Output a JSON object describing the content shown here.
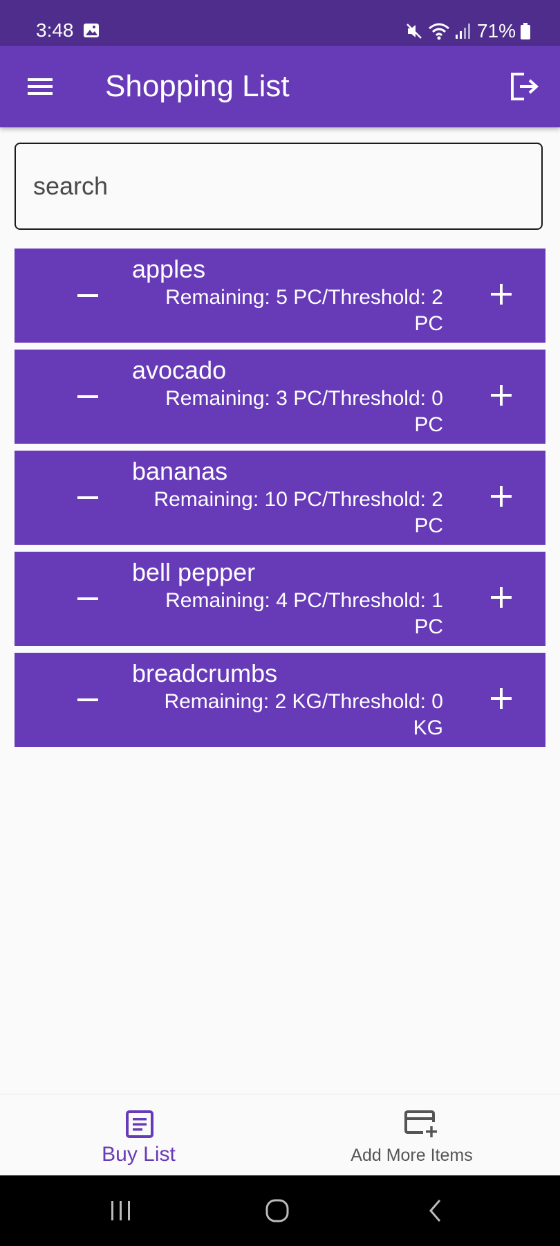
{
  "status_bar": {
    "time": "3:48",
    "battery": "71%",
    "icons": [
      "gallery-icon",
      "mute-icon",
      "wifi-icon",
      "signal-icon",
      "battery-icon"
    ]
  },
  "app_bar": {
    "title": "Shopping List",
    "icons": [
      "menu-icon",
      "logout-icon"
    ]
  },
  "search": {
    "placeholder": "search",
    "value": ""
  },
  "items": [
    {
      "name": "apples",
      "info": "Remaining: 5 PC/Threshold: 2 PC"
    },
    {
      "name": "avocado",
      "info": "Remaining: 3 PC/Threshold: 0 PC"
    },
    {
      "name": "bananas",
      "info": "Remaining: 10 PC/Threshold: 2 PC"
    },
    {
      "name": "bell pepper",
      "info": "Remaining: 4 PC/Threshold: 1 PC"
    },
    {
      "name": "breadcrumbs",
      "info": "Remaining: 2 KG/Threshold: 0 KG"
    }
  ],
  "bottom_nav": {
    "buy_list_label": "Buy List",
    "add_more_label": "Add More Items",
    "active": "Buy List"
  },
  "colors": {
    "primary": "#673ab7",
    "status_bar": "#4f2d8c",
    "background": "#fafafa",
    "inactive_nav": "#555555"
  }
}
